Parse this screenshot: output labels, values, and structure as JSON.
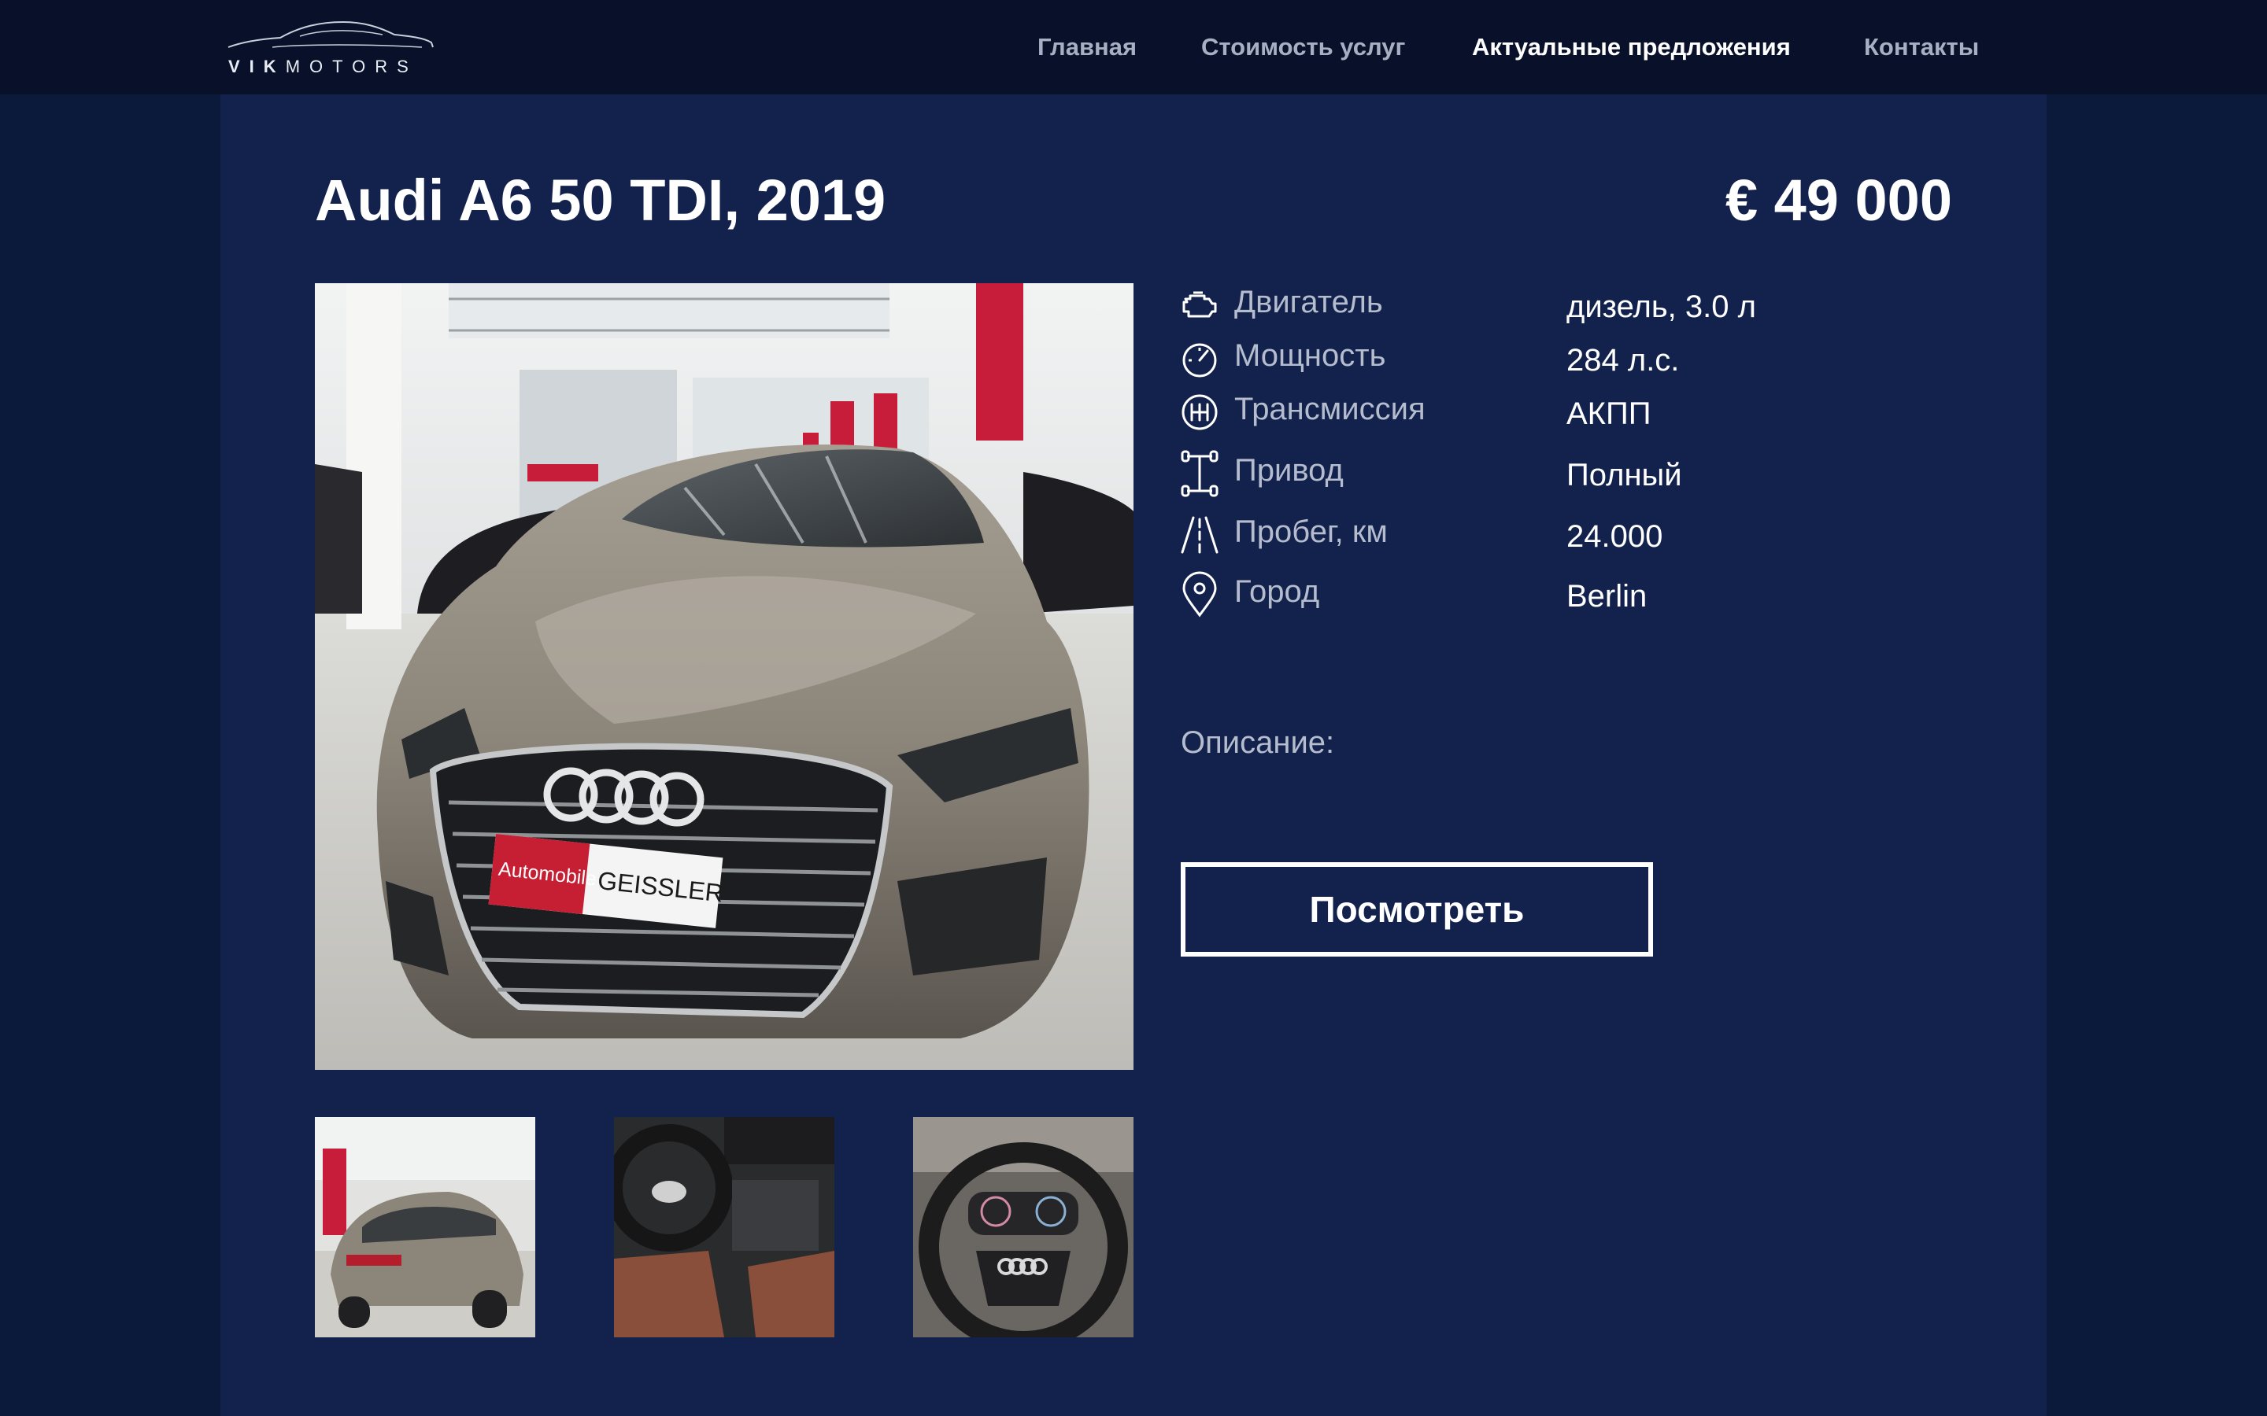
{
  "brand": {
    "logo_bold": "VIK",
    "logo_light": "MOTORS"
  },
  "nav": {
    "items": [
      {
        "label": "Главная",
        "active": false
      },
      {
        "label": "Стоимость услуг",
        "active": false
      },
      {
        "label": "Актуальные предложения",
        "active": true
      },
      {
        "label": "Контакты",
        "active": false
      }
    ]
  },
  "listing": {
    "title": "Audi A6 50 TDI, 2019",
    "price": "€ 49 000",
    "main_photo_icon": "car-front-photo",
    "plate_left": "Automobile",
    "plate_right": "GEISSLER",
    "specs": [
      {
        "label": "Двигатель",
        "value": "дизель, 3.0 л",
        "icon": "engine-icon"
      },
      {
        "label": "Мощность",
        "value": "284 л.с.",
        "icon": "speedometer-icon"
      },
      {
        "label": "Трансмиссия",
        "value": "АКПП",
        "icon": "gearbox-icon"
      },
      {
        "label": "Привод",
        "value": "Полный",
        "icon": "drivetrain-icon"
      },
      {
        "label": "Пробег, км",
        "value": "24.000",
        "icon": "road-icon"
      },
      {
        "label": "Город",
        "value": "Berlin",
        "icon": "location-pin-icon"
      }
    ],
    "description_label": "Описание:",
    "cta_label": "Посмотреть",
    "thumbnails": [
      {
        "icon": "car-rear-photo"
      },
      {
        "icon": "car-interior-photo"
      },
      {
        "icon": "steering-wheel-photo"
      }
    ]
  },
  "colors": {
    "topbar": "#081129",
    "page_bg": "#0b1a3b",
    "panel": "#13224d",
    "text": "#ffffff",
    "muted": "#b4bccd"
  }
}
